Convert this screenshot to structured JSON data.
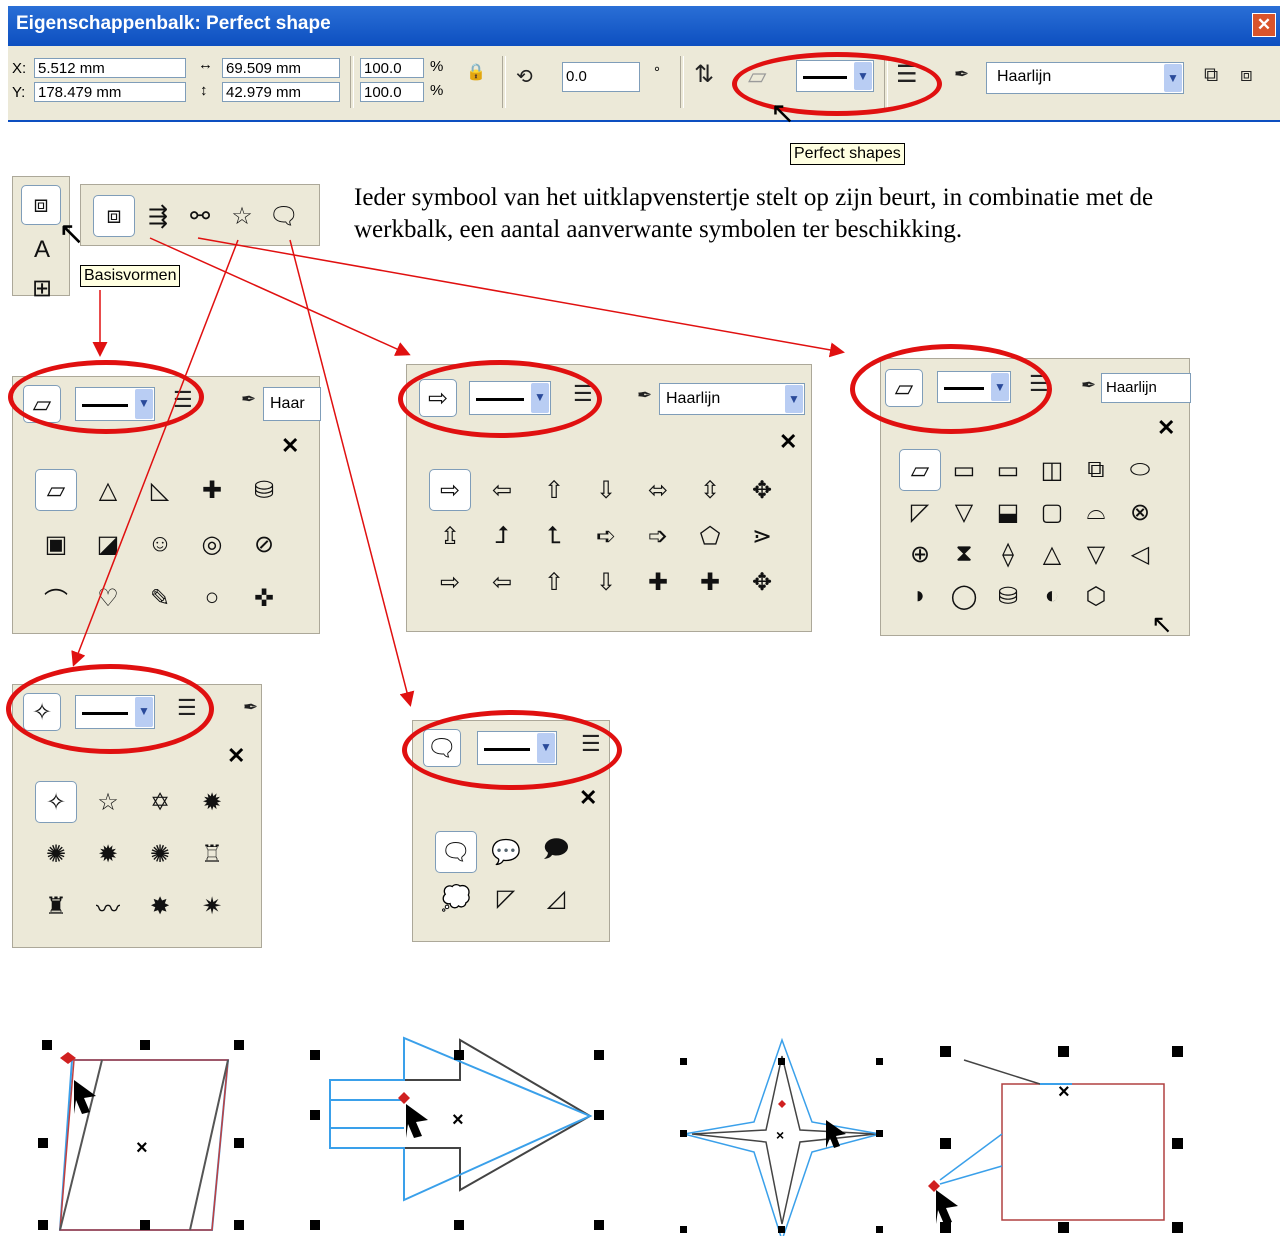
{
  "window": {
    "title": "Eigenschappenbalk: Perfect shape",
    "close_symbol": "✕"
  },
  "toolbar": {
    "x_label": "X:",
    "x_value": "5.512 mm",
    "y_label": "Y:",
    "y_value": "178.479 mm",
    "width_value": "69.509 mm",
    "height_value": "42.979 mm",
    "scale_x": "100.0",
    "scale_y": "100.0",
    "pct": "%",
    "rotation": "0.0",
    "degree_symbol": "°",
    "outline_width": "Haarlijn",
    "tooltip": "Perfect shapes"
  },
  "flyout": {
    "tooltip": "Basisvormen"
  },
  "description": "Ieder symbool van het uitklapvenstertje stelt op zijn beurt, in combinatie met de werkbalk, een aantal aanverwante symbolen ter beschikking.",
  "panels": {
    "basic": {
      "outline": "Haar",
      "close": "✕",
      "shapes": [
        "▱",
        "△",
        "◺",
        "✚",
        "⛁",
        "▣",
        "◪",
        "☺",
        "◎",
        "⊘",
        "⌒",
        "♡",
        "✎",
        "○",
        "✜"
      ]
    },
    "arrows": {
      "outline": "Haarlijn",
      "close": "✕",
      "shapes": [
        "⇨",
        "⇦",
        "⇧",
        "⇩",
        "⬄",
        "⇳",
        "✥",
        "⇫",
        "⮥",
        "⮤",
        "➪",
        "➩",
        "⬠",
        "⋗",
        "⇨",
        "⇦",
        "⇧",
        "⇩",
        "✚",
        "✚",
        "✥"
      ]
    },
    "flowchart": {
      "outline": "Haarlijn",
      "close": "✕",
      "shapes": [
        "▱",
        "▭",
        "▭",
        "◫",
        "⧉",
        "⬭",
        "◸",
        "▽",
        "⬓",
        "▢",
        "⌓",
        "⊗",
        "⊕",
        "⧗",
        "⟠",
        "△",
        "▽",
        "◁",
        "◗",
        "◯",
        "⛁",
        "◐",
        "⬡"
      ]
    },
    "stars": {
      "close": "✕",
      "shapes": [
        "✧",
        "☆",
        "✡",
        "✹",
        "✺",
        "✹",
        "✺",
        "♖",
        "♜",
        "〰",
        "✸",
        "✷"
      ]
    },
    "callouts": {
      "close": "✕",
      "shapes": [
        "🗨",
        "💬",
        "🗩",
        "💭",
        "◸",
        "◿"
      ]
    }
  }
}
